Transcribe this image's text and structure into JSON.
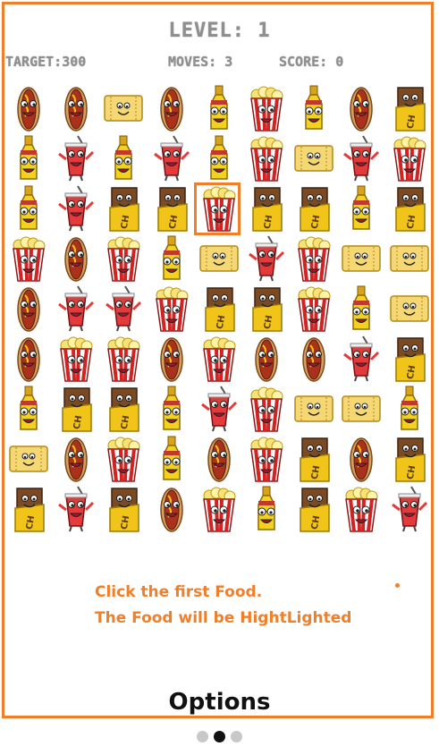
{
  "header": {
    "level_text": "LEVEL: 1",
    "target_text": "TARGET:300",
    "moves_text": "MOVES: 3",
    "score_text": "SCORE: 0"
  },
  "board": {
    "rows": 9,
    "cols": 9,
    "selected": {
      "row": 2,
      "col": 4
    },
    "cells": [
      [
        "hotdog",
        "hotdog",
        "ticket",
        "hotdog",
        "bottle",
        "popcorn",
        "bottle",
        "hotdog",
        "chocolate"
      ],
      [
        "bottle",
        "soda",
        "bottle",
        "soda",
        "bottle",
        "popcorn",
        "ticket",
        "soda",
        "popcorn"
      ],
      [
        "bottle",
        "soda",
        "chocolate",
        "chocolate",
        "popcorn",
        "chocolate",
        "chocolate",
        "bottle",
        "chocolate"
      ],
      [
        "popcorn",
        "hotdog",
        "popcorn",
        "bottle",
        "ticket",
        "soda",
        "popcorn",
        "ticket",
        "ticket"
      ],
      [
        "hotdog",
        "soda",
        "soda",
        "popcorn",
        "chocolate",
        "chocolate",
        "popcorn",
        "bottle",
        "ticket"
      ],
      [
        "hotdog",
        "popcorn",
        "popcorn",
        "hotdog",
        "popcorn",
        "hotdog",
        "hotdog",
        "soda",
        "chocolate"
      ],
      [
        "bottle",
        "chocolate",
        "chocolate",
        "bottle",
        "soda",
        "popcorn",
        "ticket",
        "ticket",
        "bottle"
      ],
      [
        "ticket",
        "hotdog",
        "popcorn",
        "bottle",
        "hotdog",
        "popcorn",
        "chocolate",
        "hotdog",
        "chocolate"
      ],
      [
        "chocolate",
        "soda",
        "chocolate",
        "hotdog",
        "popcorn",
        "bottle",
        "chocolate",
        "popcorn",
        "soda"
      ]
    ]
  },
  "hint": {
    "line1": "Click the first Food.",
    "line2": "The Food will be HightLighted"
  },
  "options_label": "Options",
  "pager": {
    "count": 3,
    "active": 1
  },
  "colors": {
    "accent": "#f07f2a",
    "stat_text": "#8f8f8f"
  }
}
